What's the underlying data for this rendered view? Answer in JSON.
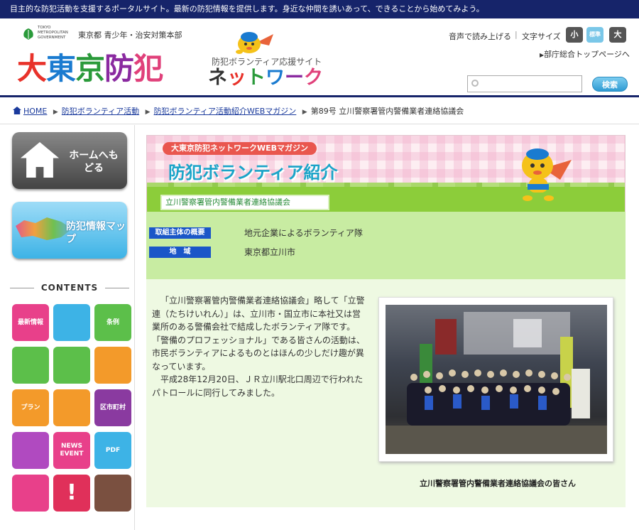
{
  "topbar": {
    "text": "目主的な防犯活動を支援するポータルサイト。最新の防犯情報を提供します。身近な仲間を誘いあって、できることから始めてみよう。"
  },
  "header": {
    "gov_en": "TOKYO METROPOLITAN GOVERNMENT",
    "gov_ja": "東京都 青少年・治安対策本部",
    "site_title": [
      "大",
      "東",
      "京",
      "防",
      "犯"
    ],
    "site_title_colors": [
      "#e8322a",
      "#1a7bd0",
      "#2a9a3a",
      "#8a2aa0",
      "#e0407a"
    ],
    "site_subtitle": "防犯ボランティア応援サイト",
    "site_net": [
      "ネ",
      "ッ",
      "ト",
      "ワ",
      "ー",
      "ク"
    ],
    "site_net_colors": [
      "#333333",
      "#e8322a",
      "#2a9a3a",
      "#1a7bd0",
      "#8a2aa0",
      "#e0407a"
    ],
    "voice_link": "音声で読み上げる",
    "separator": "|",
    "font_size_label": "文字サイズ",
    "font_small": "小",
    "font_standard": "標準",
    "font_large": "大",
    "top_link": "部庁総合トップページへ",
    "search_placeholder": "",
    "search_button": "検索"
  },
  "breadcrumb": {
    "home": "HOME",
    "items": [
      "防犯ボランティア活動",
      "防犯ボランティア活動紹介WEBマガジン"
    ],
    "current": "第89号 立川警察署管内警備業者連絡協議会"
  },
  "sidebar": {
    "home_button": "ホームへもどる",
    "map_button": "防犯情報マップ",
    "contents_heading": "CONTENTS",
    "tiles": [
      {
        "label": "最新情報",
        "color": "#e8408a"
      },
      {
        "label": "",
        "color": "#3db3e6"
      },
      {
        "label": "条例",
        "color": "#5cbf4a"
      },
      {
        "label": "",
        "color": "#5cbf4a"
      },
      {
        "label": "",
        "color": "#5cbf4a"
      },
      {
        "label": "",
        "color": "#f39a2a"
      },
      {
        "label": "プラン",
        "color": "#f39a2a"
      },
      {
        "label": "",
        "color": "#f39a2a"
      },
      {
        "label": "区市町村",
        "color": "#8a3aa0"
      },
      {
        "label": "",
        "color": "#b04ac0"
      },
      {
        "label": "NEWS EVENT",
        "color": "#e8408a"
      },
      {
        "label": "PDF",
        "color": "#3db3e6"
      },
      {
        "label": "",
        "color": "#e8408a"
      },
      {
        "label": "!",
        "color": "#e0305a"
      },
      {
        "label": "",
        "color": "#7a5040"
      }
    ]
  },
  "content": {
    "magazine_tag": "大東京防犯ネットワークWEBマガジン",
    "magazine_title": "防犯ボランティア紹介",
    "topic_label": "立川警察署管内警備業者連絡協議会",
    "info": [
      {
        "key": "取組主体の概要",
        "value": "地元企業によるボランティア隊"
      },
      {
        "key": "地　域",
        "value": "東京都立川市"
      }
    ],
    "article": [
      "「立川警察署管内警備業者連絡協議会」略して「立警連（たちけいれん）」は、立川市・国立市に本社又は営業所のある警備会社で結成したボランティア隊です。「警備のプロフェッショナル」である皆さんの活動は、市民ボランティアによるものとはほんの少しだけ趣が異なっています。",
      "平成28年12月20日、ＪＲ立川駅北口周辺で行われたパトロールに同行してみました。"
    ],
    "photo_caption": "立川警察署管内警備業者連絡協議会の皆さん"
  }
}
